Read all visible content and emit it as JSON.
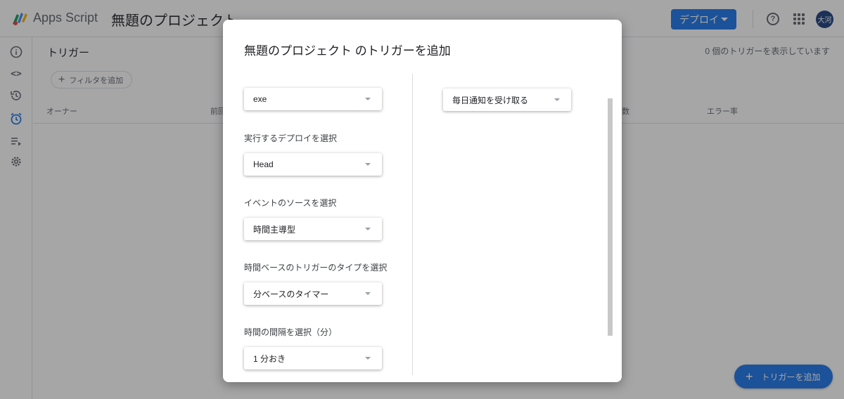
{
  "header": {
    "app_name": "Apps Script",
    "project_title": "無題のプロジェクト",
    "deploy_label": "デプロイ",
    "avatar_text": "大河"
  },
  "sidebar": {
    "icons": [
      "info-icon",
      "code-icon",
      "history-icon",
      "triggers-icon",
      "executions-icon",
      "settings-icon"
    ]
  },
  "content": {
    "title": "トリガー",
    "triggers_count": "0 個のトリガーを表示しています",
    "filter_label": "フィルタを追加",
    "columns": {
      "owner": "オーナー",
      "prev": "前回",
      "count": "数",
      "error_rate": "エラー率"
    },
    "add_trigger_label": "トリガーを追加"
  },
  "modal": {
    "title": "無題のプロジェクト のトリガーを追加",
    "function_value": "exe",
    "deploy_label": "実行するデプロイを選択",
    "deploy_value": "Head",
    "event_source_label": "イベントのソースを選択",
    "event_source_value": "時間主導型",
    "time_type_label": "時間ベースのトリガーのタイプを選択",
    "time_type_value": "分ベースのタイマー",
    "interval_label": "時間の間隔を選択（分）",
    "interval_value": "1 分おき",
    "notify_value": "毎日通知を受け取る"
  },
  "colors": {
    "accent": "#1a73e8",
    "avatar_bg": "#1a3d7c",
    "overlay": "rgba(32,33,36,0.40)"
  }
}
